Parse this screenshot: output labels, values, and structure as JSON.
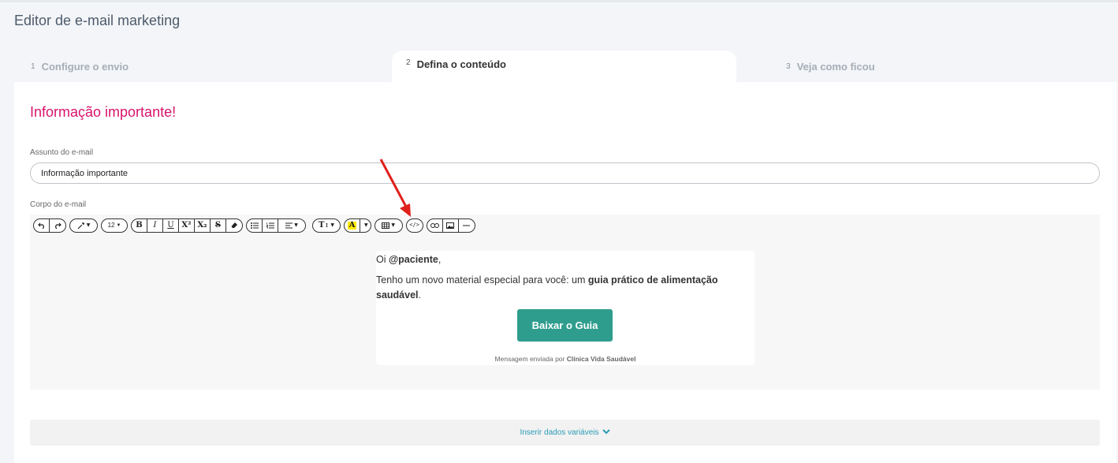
{
  "page": {
    "title": "Editor de e-mail marketing"
  },
  "steps": [
    {
      "num": "1",
      "label": "Configure o envio"
    },
    {
      "num": "2",
      "label": "Defina o conteúdo"
    },
    {
      "num": "3",
      "label": "Veja como ficou"
    }
  ],
  "content": {
    "heading": "Informação importante!",
    "subject_label": "Assunto do e-mail",
    "subject_value": "Informação importante",
    "body_label": "Corpo do e-mail"
  },
  "toolbar": {
    "font_size": "12",
    "bold": "B",
    "italic": "I",
    "underline": "U",
    "superscript": "X²",
    "subscript": "X₂",
    "strikethrough": "S",
    "text_style": "T",
    "highlight": "A",
    "icons": [
      "undo-icon",
      "redo-icon",
      "magic-wand-icon",
      "font-size-icon",
      "bold-icon",
      "italic-icon",
      "underline-icon",
      "superscript-icon",
      "subscript-icon",
      "strikethrough-icon",
      "eraser-icon",
      "unordered-list-icon",
      "ordered-list-icon",
      "align-icon",
      "text-height-icon",
      "highlight-color-icon",
      "table-icon",
      "code-view-icon",
      "link-icon",
      "image-icon",
      "horizontal-rule-icon"
    ]
  },
  "email": {
    "greeting_prefix": "Oi ",
    "greeting_name": "@paciente",
    "greeting_suffix": ",",
    "message_prefix": "Tenho um novo material especial para você: um ",
    "message_bold": "guia prático de alimentação saudável",
    "message_suffix": ".",
    "button": "Baixar o Guia",
    "footer_prefix": "Mensagem enviada por ",
    "footer_clinic": "Clínica Vida Saudável",
    "button_color": "#2f9d8d"
  },
  "variables": {
    "label": "Inserir dados variáveis"
  },
  "colors": {
    "accent": "#d8136c",
    "link": "#2b9bb5",
    "annotation": "#e0201b"
  }
}
